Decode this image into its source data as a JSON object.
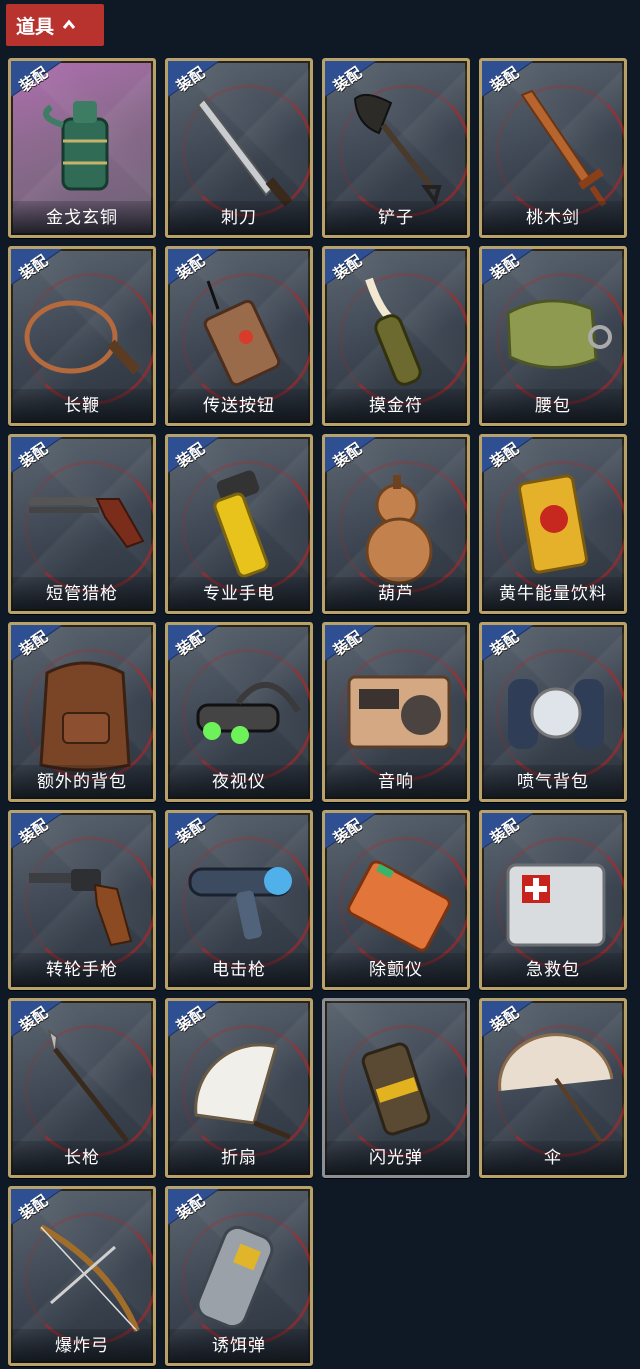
{
  "header": {
    "title": "道具"
  },
  "equip_badge": "装配",
  "items": [
    {
      "name": "金戈玄铜",
      "icon": "bronze-grenade-icon",
      "equip": true,
      "special": true
    },
    {
      "name": "刺刀",
      "icon": "bayonet-icon",
      "equip": true
    },
    {
      "name": "铲子",
      "icon": "shovel-icon",
      "equip": true
    },
    {
      "name": "桃木剑",
      "icon": "peachwood-sword-icon",
      "equip": true
    },
    {
      "name": "长鞭",
      "icon": "whip-icon",
      "equip": true
    },
    {
      "name": "传送按钮",
      "icon": "teleport-button-icon",
      "equip": true
    },
    {
      "name": "摸金符",
      "icon": "talisman-icon",
      "equip": true
    },
    {
      "name": "腰包",
      "icon": "waist-bag-icon",
      "equip": true
    },
    {
      "name": "短管猎枪",
      "icon": "shotgun-icon",
      "equip": true
    },
    {
      "name": "专业手电",
      "icon": "flashlight-icon",
      "equip": true
    },
    {
      "name": "葫芦",
      "icon": "gourd-icon",
      "equip": true
    },
    {
      "name": "黄牛能量饮料",
      "icon": "energy-drink-icon",
      "equip": true
    },
    {
      "name": "额外的背包",
      "icon": "backpack-icon",
      "equip": true
    },
    {
      "name": "夜视仪",
      "icon": "night-vision-icon",
      "equip": true
    },
    {
      "name": "音响",
      "icon": "radio-icon",
      "equip": true
    },
    {
      "name": "喷气背包",
      "icon": "jetpack-icon",
      "equip": true
    },
    {
      "name": "转轮手枪",
      "icon": "revolver-icon",
      "equip": true
    },
    {
      "name": "电击枪",
      "icon": "shock-gun-icon",
      "equip": true
    },
    {
      "name": "除颤仪",
      "icon": "defibrillator-icon",
      "equip": true
    },
    {
      "name": "急救包",
      "icon": "first-aid-kit-icon",
      "equip": true
    },
    {
      "name": "长枪",
      "icon": "spear-icon",
      "equip": true
    },
    {
      "name": "折扇",
      "icon": "folding-fan-icon",
      "equip": true
    },
    {
      "name": "闪光弹",
      "icon": "flashbang-icon",
      "equip": false
    },
    {
      "name": "伞",
      "icon": "umbrella-icon",
      "equip": true
    },
    {
      "name": "爆炸弓",
      "icon": "explosive-bow-icon",
      "equip": true
    },
    {
      "name": "诱饵弹",
      "icon": "decoy-grenade-icon",
      "equip": true
    }
  ]
}
